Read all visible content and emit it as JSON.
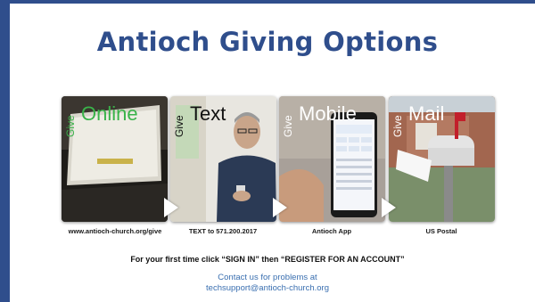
{
  "slide": {
    "title": "Antioch Giving Options",
    "instruction": "For your first time click “SIGN IN” then “REGISTER FOR AN ACCOUNT”",
    "contact_line1": "Contact us for problems at",
    "contact_line2": "techsupport@antioch-church.org"
  },
  "options": [
    {
      "give": "Give",
      "method": "Online",
      "caption": "www.antioch-church.org/give",
      "accent": "#3ab34a"
    },
    {
      "give": "Give",
      "method": "Text",
      "caption": "TEXT to 571.200.2017",
      "accent": "#111111"
    },
    {
      "give": "Give",
      "method": "Mobile",
      "caption": "Antioch App",
      "accent": "#ffffff"
    },
    {
      "give": "Give",
      "method": "Mail",
      "caption": "US Postal",
      "accent": "#ffffff"
    }
  ],
  "colors": {
    "brand": "#2f4e8c",
    "link": "#3a6fb0"
  }
}
